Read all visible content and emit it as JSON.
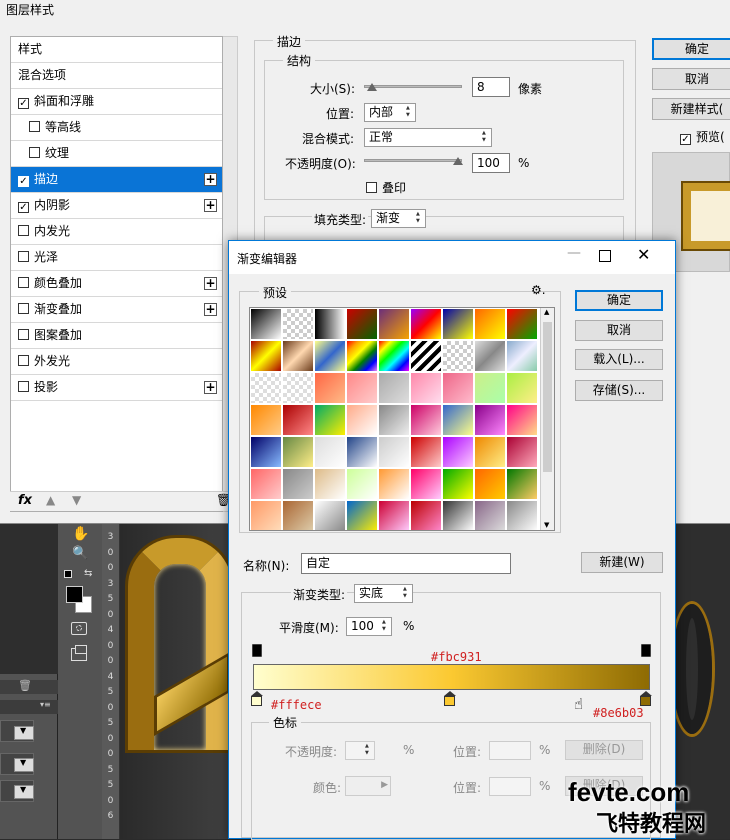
{
  "bg_dialog": {
    "title": "图层样式",
    "styles": [
      {
        "label": "样式",
        "check": false,
        "hascb": false,
        "plus": false,
        "indent": false
      },
      {
        "label": "混合选项",
        "check": false,
        "hascb": false,
        "plus": false,
        "indent": false
      },
      {
        "label": "斜面和浮雕",
        "check": true,
        "hascb": true,
        "plus": false,
        "indent": false
      },
      {
        "label": "等高线",
        "check": false,
        "hascb": true,
        "plus": false,
        "indent": true
      },
      {
        "label": "纹理",
        "check": false,
        "hascb": true,
        "plus": false,
        "indent": true
      },
      {
        "label": "描边",
        "check": true,
        "hascb": true,
        "plus": true,
        "indent": false,
        "active": true
      },
      {
        "label": "内阴影",
        "check": true,
        "hascb": true,
        "plus": true,
        "indent": false
      },
      {
        "label": "内发光",
        "check": false,
        "hascb": true,
        "plus": false,
        "indent": false
      },
      {
        "label": "光泽",
        "check": false,
        "hascb": true,
        "plus": false,
        "indent": false
      },
      {
        "label": "颜色叠加",
        "check": false,
        "hascb": true,
        "plus": true,
        "indent": false
      },
      {
        "label": "渐变叠加",
        "check": false,
        "hascb": true,
        "plus": true,
        "indent": false
      },
      {
        "label": "图案叠加",
        "check": false,
        "hascb": true,
        "plus": false,
        "indent": false
      },
      {
        "label": "外发光",
        "check": false,
        "hascb": true,
        "plus": false,
        "indent": false
      },
      {
        "label": "投影",
        "check": false,
        "hascb": true,
        "plus": true,
        "indent": false
      }
    ],
    "fx": "fx",
    "stroke": {
      "group": "描边",
      "struct": "结构",
      "size_label": "大小(S):",
      "size_value": "8",
      "size_unit": "像素",
      "pos_label": "位置:",
      "pos_value": "内部",
      "blend_label": "混合模式:",
      "blend_value": "正常",
      "opacity_label": "不透明度(O):",
      "opacity_value": "100",
      "opacity_unit": "%",
      "overprint": "叠印",
      "fill_label": "填充类型:",
      "fill_value": "渐变"
    },
    "buttons": {
      "ok": "确定",
      "cancel": "取消",
      "newstyle": "新建样式(",
      "preview": "预览("
    }
  },
  "ge": {
    "title": "渐变编辑器",
    "presets": "预设",
    "ok": "确定",
    "cancel": "取消",
    "load": "载入(L)...",
    "save": "存储(S)...",
    "name_label": "名称(N):",
    "name_value": "自定",
    "new_btn": "新建(W)",
    "type_label": "渐变类型:",
    "type_value": "实底",
    "smooth_label": "平滑度(M):",
    "smooth_value": "100",
    "smooth_unit": "%",
    "stops_group": "色标",
    "opacity_label": "不透明度:",
    "opacity_unit": "%",
    "pos_label": "位置:",
    "pos_unit": "%",
    "delete": "删除(D)",
    "color_label": "颜色:",
    "pos_label2": "位置:",
    "pos_unit2": "%",
    "delete2": "删除(D)"
  },
  "annotations": {
    "mid": "#fbc931",
    "left": "#fffece",
    "right": "#8e6b03"
  },
  "gradient": {
    "stops": [
      {
        "color": "#fffece",
        "pos": 0
      },
      {
        "color": "#fbc931",
        "pos": 50
      },
      {
        "color": "#8e6b03",
        "pos": 100
      }
    ]
  },
  "ruler": [
    "3",
    "0",
    "0",
    "3",
    "5",
    "0",
    "4",
    "0",
    "0",
    "4",
    "5",
    "0",
    "5",
    "0",
    "0",
    "5",
    "5",
    "0",
    "6"
  ],
  "watermark": {
    "domain": "fevte.com",
    "sub": "飞特教程网"
  },
  "colors": {
    "accent": "#0078d7",
    "c1": "#fffece",
    "c2": "#fbc931",
    "c3": "#8e6b03"
  }
}
